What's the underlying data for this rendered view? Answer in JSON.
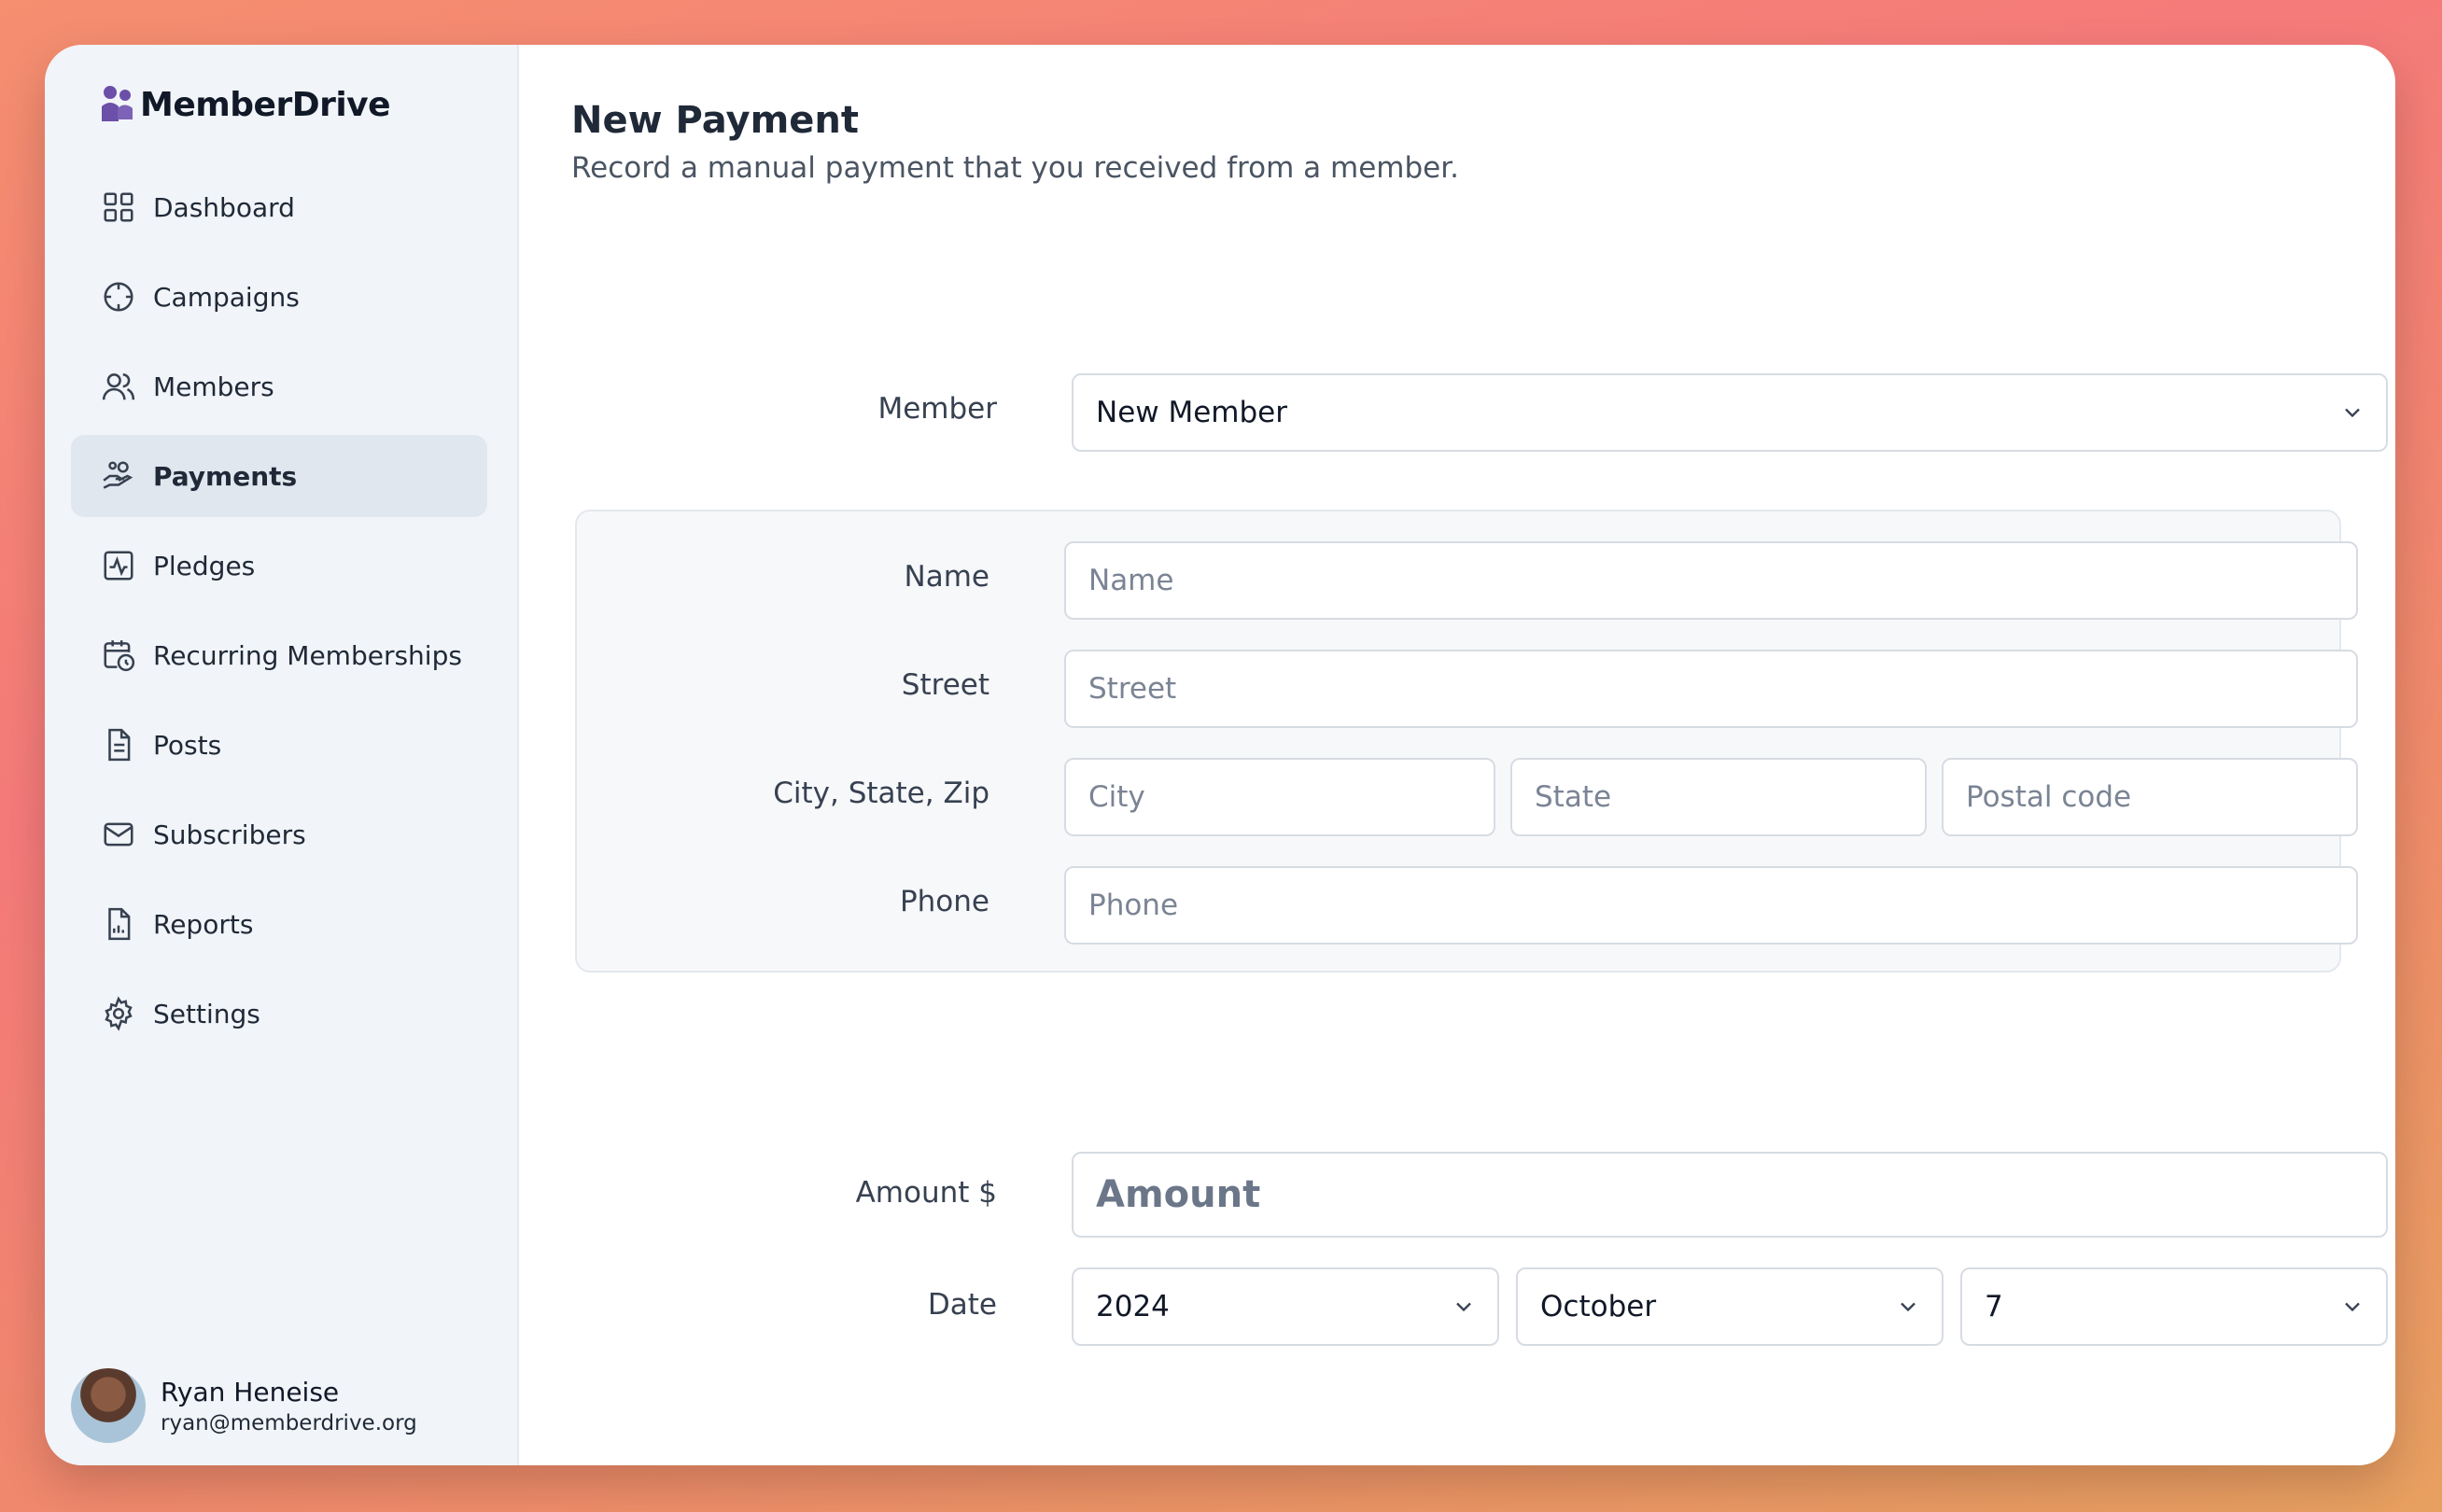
{
  "brand": {
    "name": "MemberDrive",
    "color": "#6b4fa8"
  },
  "sidebar": {
    "items": [
      {
        "label": "Dashboard",
        "icon": "grid-icon"
      },
      {
        "label": "Campaigns",
        "icon": "crosshair-icon"
      },
      {
        "label": "Members",
        "icon": "users-icon"
      },
      {
        "label": "Payments",
        "icon": "hand-coins-icon",
        "active": true
      },
      {
        "label": "Pledges",
        "icon": "activity-chart-icon"
      },
      {
        "label": "Recurring Memberships",
        "icon": "calendar-clock-icon"
      },
      {
        "label": "Posts",
        "icon": "document-icon"
      },
      {
        "label": "Subscribers",
        "icon": "mail-icon"
      },
      {
        "label": "Reports",
        "icon": "report-icon"
      },
      {
        "label": "Settings",
        "icon": "gear-icon"
      }
    ]
  },
  "user": {
    "name": "Ryan Heneise",
    "email": "ryan@memberdrive.org"
  },
  "page": {
    "title": "New Payment",
    "subtitle": "Record a manual payment that you received from a member."
  },
  "form": {
    "member_label": "Member",
    "member_value": "New Member",
    "name_label": "Name",
    "name_placeholder": "Name",
    "street_label": "Street",
    "street_placeholder": "Street",
    "city_label": "City, State, Zip",
    "city_placeholder": "City",
    "state_placeholder": "State",
    "zip_placeholder": "Postal code",
    "phone_label": "Phone",
    "phone_placeholder": "Phone",
    "amount_label": "Amount $",
    "amount_placeholder": "Amount",
    "date_label": "Date",
    "date_year": "2024",
    "date_month": "October",
    "date_day": "7"
  }
}
